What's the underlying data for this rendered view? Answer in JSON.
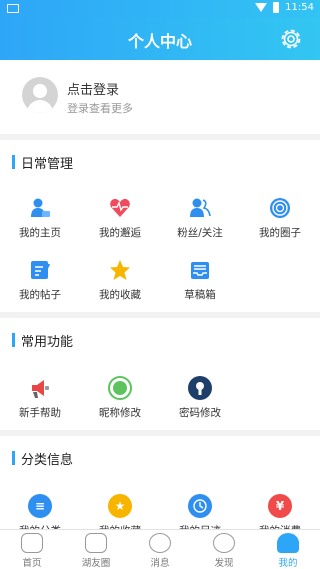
{
  "status_bar": {
    "time": "11:54"
  },
  "header": {
    "title": "个人中心"
  },
  "login": {
    "prompt": "点击登录",
    "hint": "登录查看更多"
  },
  "sections": {
    "daily": {
      "title": "日常管理",
      "items": [
        {
          "label": "我的主页",
          "icon": "person-card-icon",
          "color": "#2e8ff0"
        },
        {
          "label": "我的邂逅",
          "icon": "heart-pulse-icon",
          "color": "#f04a5c"
        },
        {
          "label": "粉丝/关注",
          "icon": "people-icon",
          "color": "#2e8ff0"
        },
        {
          "label": "我的圈子",
          "icon": "target-circle-icon",
          "color": "#2e8ff0"
        },
        {
          "label": "我的帖子",
          "icon": "edit-note-icon",
          "color": "#2e8ff0"
        },
        {
          "label": "我的收藏",
          "icon": "star-icon",
          "color": "#f7b500"
        },
        {
          "label": "草稿箱",
          "icon": "inbox-tray-icon",
          "color": "#2e8ff0"
        }
      ]
    },
    "common": {
      "title": "常用功能",
      "items": [
        {
          "label": "新手帮助",
          "icon": "help-megaphone-icon",
          "color": "#e84545"
        },
        {
          "label": "昵称修改",
          "icon": "rename-badge-icon",
          "color": "#5cc35e"
        },
        {
          "label": "密码修改",
          "icon": "keyhole-icon",
          "color": "#1e3f6a"
        }
      ]
    },
    "category": {
      "title": "分类信息",
      "items": [
        {
          "label": "我的分类",
          "icon": "list-circle-icon",
          "color": "#2e8ff0"
        },
        {
          "label": "我的收藏",
          "icon": "star-badge-icon",
          "color": "#f7b500"
        },
        {
          "label": "我的足迹",
          "icon": "clock-icon",
          "color": "#2e8ff0"
        },
        {
          "label": "我的消费",
          "icon": "yen-icon",
          "color": "#f04a4a"
        }
      ]
    }
  },
  "tabs": [
    {
      "label": "首页",
      "icon": "home-icon"
    },
    {
      "label": "湖友圈",
      "icon": "chat-bubble-icon"
    },
    {
      "label": "消息",
      "icon": "message-icon"
    },
    {
      "label": "发现",
      "icon": "compass-icon"
    },
    {
      "label": "我的",
      "icon": "profile-icon",
      "active": true
    }
  ],
  "colors": {
    "accent": "#2ea6f7"
  }
}
